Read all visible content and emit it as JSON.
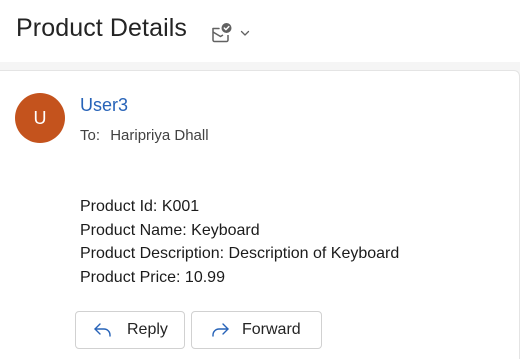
{
  "header": {
    "title": "Product Details"
  },
  "message": {
    "avatar_initial": "U",
    "sender": "User3",
    "to_label": "To:",
    "recipient": "Haripriya Dhall",
    "body_lines": [
      "Product Id: K001",
      "Product Name: Keyboard",
      "Product Description: Description of Keyboard",
      "Product Price: 10.99"
    ]
  },
  "actions": {
    "reply_label": "Reply",
    "forward_label": "Forward"
  },
  "colors": {
    "avatar": "#c4531d",
    "sender": "#2763b8",
    "page_background": "#f5f5f5"
  },
  "icons": {
    "header_action": "mail-check-icon",
    "header_chevron": "chevron-down-icon",
    "reply": "reply-arrow-icon",
    "forward": "forward-arrow-icon"
  }
}
